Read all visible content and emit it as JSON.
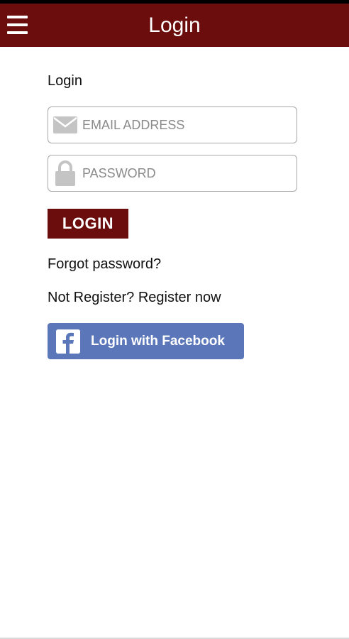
{
  "app_bar": {
    "title": "Login",
    "menu_icon": "hamburger-menu-icon",
    "background_color": "#6b0d0d"
  },
  "form": {
    "section_label": "Login",
    "email": {
      "placeholder": "EMAIL ADDRESS",
      "value": "",
      "icon": "envelope-icon"
    },
    "password": {
      "placeholder": "PASSWORD",
      "value": "",
      "icon": "lock-icon"
    },
    "login_button_label": "LOGIN",
    "forgot_password_label": "Forgot password?",
    "register_label": "Not Register? Register now"
  },
  "facebook": {
    "button_label": "Login with Facebook",
    "icon": "facebook-icon",
    "color": "#5b77ba"
  }
}
